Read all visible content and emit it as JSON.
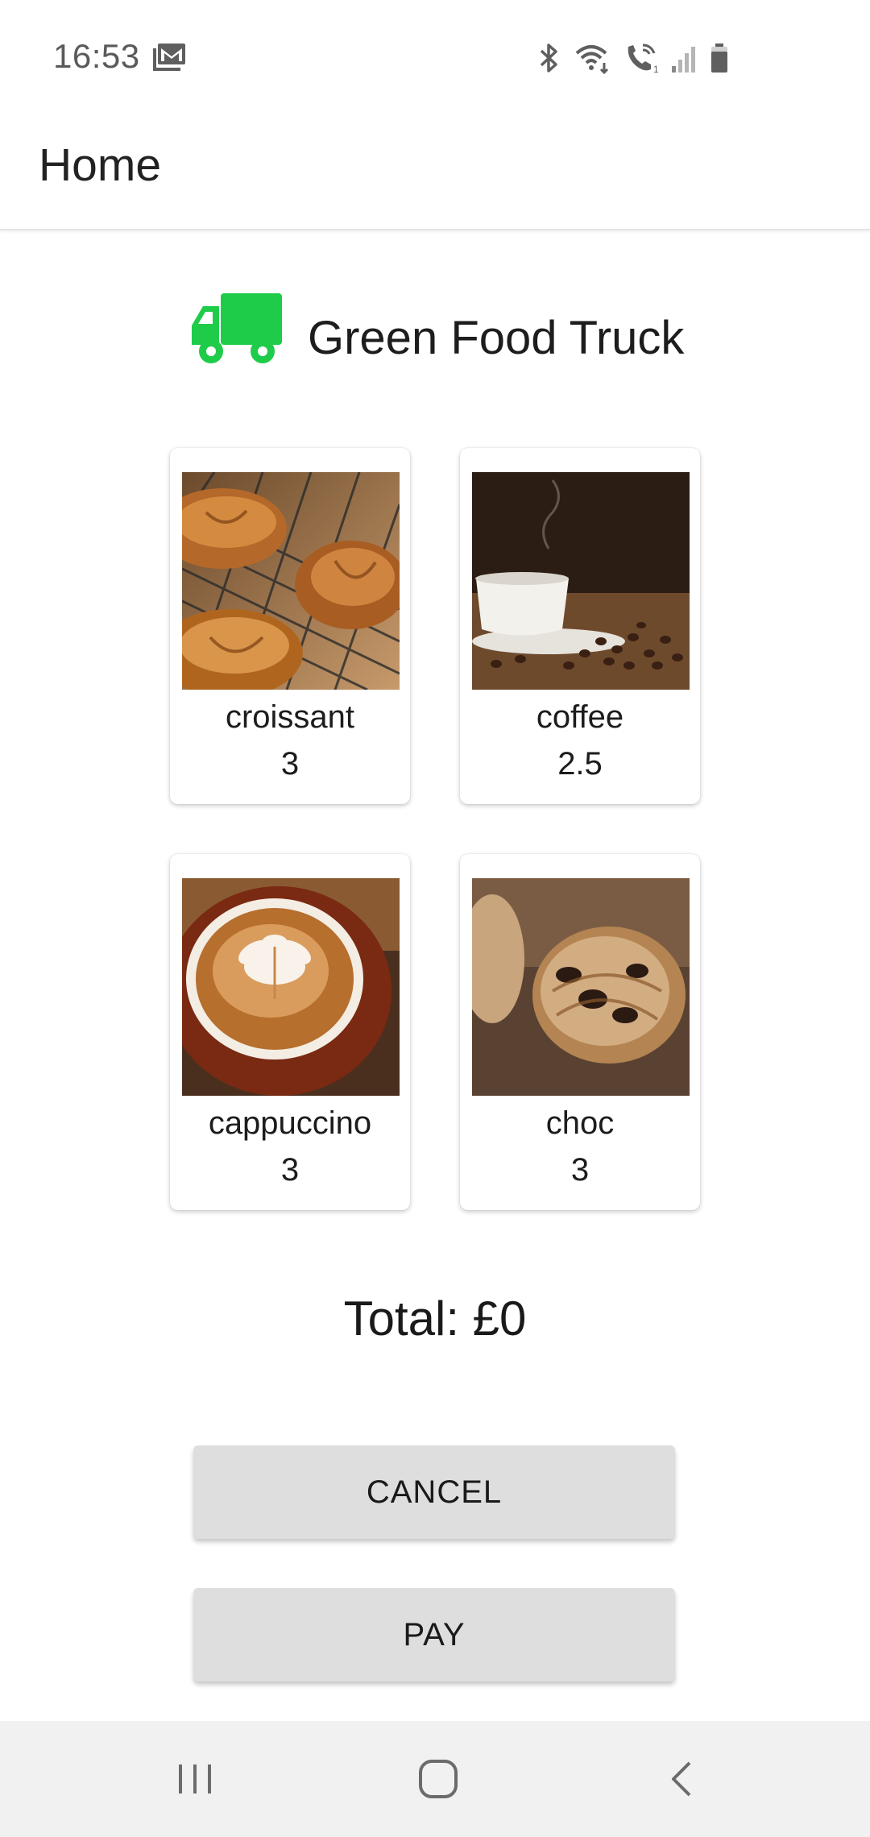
{
  "status_bar": {
    "time": "16:53",
    "notification_icon": "gmail-icon",
    "icons": [
      "bluetooth-icon",
      "wifi-icon",
      "wifi-calling-icon",
      "signal-icon",
      "battery-icon"
    ]
  },
  "app_bar": {
    "title": "Home"
  },
  "brand": {
    "icon": "truck-icon",
    "icon_color": "#1fcc4a",
    "name": "Green Food Truck"
  },
  "menu": {
    "items": [
      {
        "name": "croissant",
        "price": "3",
        "image": "croissant-image"
      },
      {
        "name": "coffee",
        "price": "2.5",
        "image": "coffee-image"
      },
      {
        "name": "cappuccino",
        "price": "3",
        "image": "cappuccino-image"
      },
      {
        "name": "choc",
        "price": "3",
        "image": "pain-au-chocolat-image"
      }
    ]
  },
  "order": {
    "total_label": "Total: £0"
  },
  "actions": {
    "cancel_label": "CANCEL",
    "pay_label": "PAY"
  },
  "nav_bar": {
    "buttons": [
      "recent-apps-icon",
      "home-icon",
      "back-icon"
    ],
    "background": "#f1f1f1"
  }
}
